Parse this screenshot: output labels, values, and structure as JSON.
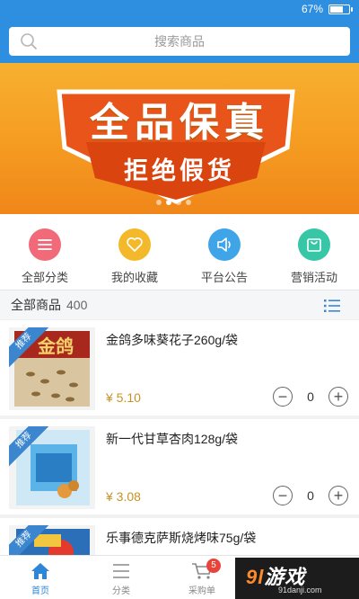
{
  "status": {
    "battery": "67%",
    "battery_level": 0.67
  },
  "search": {
    "placeholder": "搜索商品",
    "icon": "search-icon"
  },
  "banner": {
    "title": "全品保真",
    "subtitle": "拒绝假货",
    "slides": 4,
    "active_slide": 2
  },
  "shortcuts": [
    {
      "label": "全部分类",
      "icon": "menu-icon",
      "color": "#f06a7a"
    },
    {
      "label": "我的收藏",
      "icon": "heart-icon",
      "color": "#f3b92b"
    },
    {
      "label": "平台公告",
      "icon": "speaker-icon",
      "color": "#3fa5e8"
    },
    {
      "label": "营销活动",
      "icon": "bag-icon",
      "color": "#37c6a6"
    }
  ],
  "list": {
    "title": "全部商品",
    "count": "400",
    "icon": "list-view-icon"
  },
  "products": [
    {
      "badge": "推荐",
      "name": "金鸽多味葵花子260g/袋",
      "price": "¥ 5.10",
      "qty": "0",
      "minus": "−",
      "plus": "+"
    },
    {
      "badge": "推荐",
      "name": "新一代甘草杏肉128g/袋",
      "price": "¥ 3.08",
      "qty": "0",
      "minus": "−",
      "plus": "+"
    },
    {
      "badge": "推荐",
      "name": "乐事德克萨斯烧烤味75g/袋"
    }
  ],
  "tabbar": [
    {
      "label": "首页",
      "icon": "home-icon",
      "active": true
    },
    {
      "label": "分类",
      "icon": "category-icon",
      "active": false
    },
    {
      "label": "采购单",
      "icon": "cart-icon",
      "active": false,
      "badge": "5"
    }
  ],
  "watermark": {
    "logo_number": "9l",
    "logo_text": "游戏",
    "url": "91danji.com"
  },
  "colors": {
    "primary": "#2e8fe0",
    "price": "#c89222",
    "banner": "#f59b21",
    "badge": "#3c86d0"
  }
}
